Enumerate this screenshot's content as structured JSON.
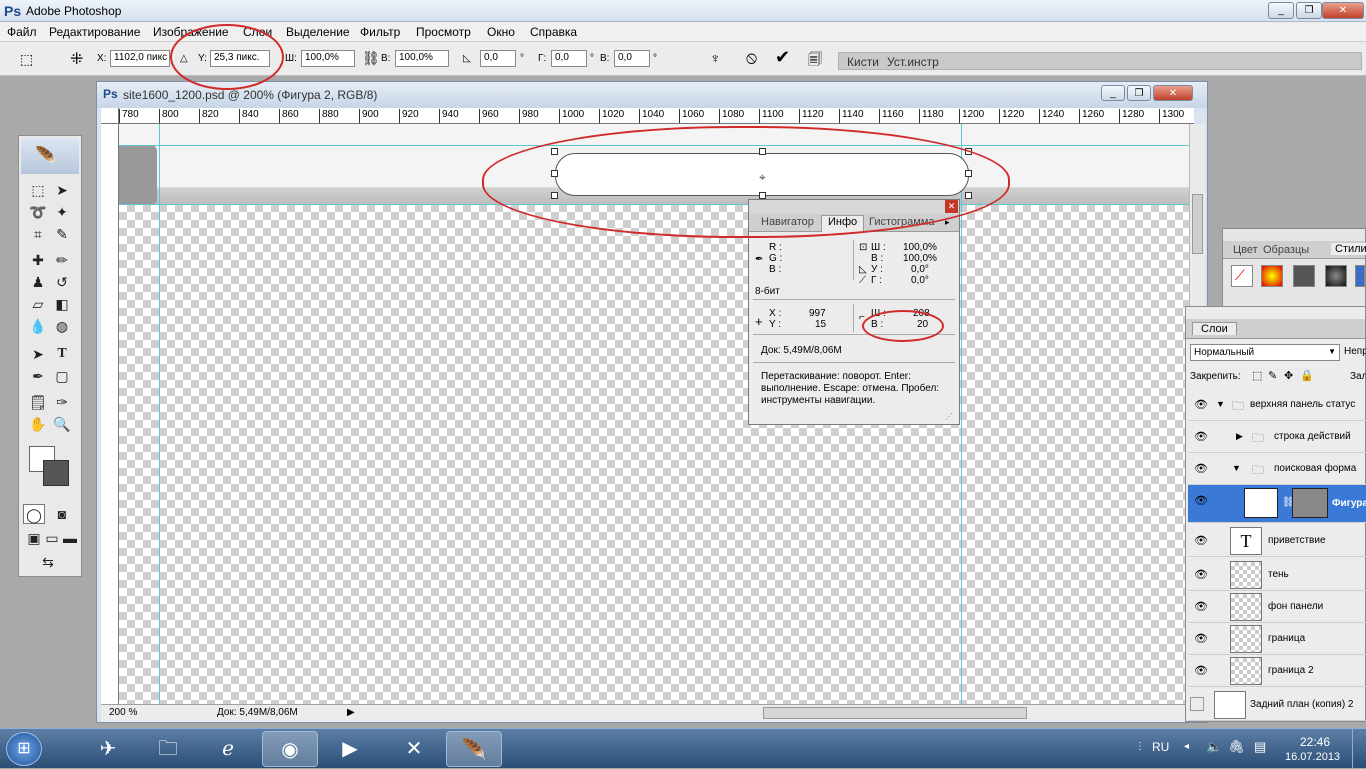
{
  "app": {
    "title": "Adobe Photoshop",
    "window_buttons": [
      "_",
      "❐",
      "✕"
    ]
  },
  "menu": [
    "Файл",
    "Редактирование",
    "Изображение",
    "Слои",
    "Выделение",
    "Фильтр",
    "Просмотр",
    "Окно",
    "Справка"
  ],
  "options": {
    "x_label": "X:",
    "x_value": "1102,0 пикс",
    "y_label": "Y:",
    "y_value": "25,3 пикс.",
    "w_label": "Ш:",
    "w_value": "100,0%",
    "h_label": "В:",
    "h_value": "100,0%",
    "angle_value": "0,0",
    "degree": "°",
    "hskew_label": "Г:",
    "hskew_value": "0,0",
    "vskew_label": "В:",
    "vskew_value": "0,0",
    "brush_tabs": [
      "Кисти",
      "Уст.инстр"
    ]
  },
  "document": {
    "title": "site1600_1200.psd @ 200% (Фигура 2, RGB/8)",
    "ruler_marks": [
      "780",
      "800",
      "820",
      "840",
      "860",
      "880",
      "900",
      "920",
      "940",
      "960",
      "980",
      "1000",
      "1020",
      "1040",
      "1060",
      "1080",
      "1100",
      "1120",
      "1140",
      "1160",
      "1180",
      "1200",
      "1220",
      "1240",
      "1260",
      "1280",
      "1300"
    ],
    "zoom": "200 %",
    "doc_status": "Док: 5,49M/8,06M"
  },
  "info_panel": {
    "tabs": [
      "Навигатор",
      "Инфо",
      "Гистограмма"
    ],
    "active_tab": "Инфо",
    "r_label": "R :",
    "g_label": "G :",
    "b_label": "B :",
    "w_label": "Ш :",
    "w_value": "100,0%",
    "h_label": "В :",
    "h_value": "100,0%",
    "u_label": "У :",
    "u_value": "0,0°",
    "g2_label": "Г :",
    "g2_value": "0,0°",
    "bit": "8-бит",
    "x_label": "X :",
    "x_value": "997",
    "y_label": "Y :",
    "y_value": "15",
    "sw_label": "Ш :",
    "sw_value": "208",
    "sh_label": "В :",
    "sh_value": "20",
    "doc": "Док: 5,49M/8,06M",
    "hint": "Перетаскивание: поворот. Enter: выполнение. Escape: отмена. Пробел: инструменты навигации."
  },
  "styles_panel": {
    "tabs": [
      "Цвет",
      "Образцы",
      "Стили"
    ]
  },
  "layers_panel": {
    "tab": "Слои",
    "blend_mode": "Нормальный",
    "opacity_label": "Непр",
    "lock_label": "Закрепить:",
    "fill_label": "Зал",
    "layers": [
      {
        "name": "верхняя панель статус",
        "type": "group",
        "indent": 0
      },
      {
        "name": "строка действий",
        "type": "group",
        "indent": 1
      },
      {
        "name": "поисковая форма",
        "type": "group",
        "indent": 1
      },
      {
        "name": "Фигура",
        "type": "shape",
        "indent": 2,
        "selected": true
      },
      {
        "name": "приветствие",
        "type": "text",
        "indent": 2
      },
      {
        "name": "тень",
        "type": "layer",
        "indent": 2
      },
      {
        "name": "фон панели",
        "type": "layer",
        "indent": 2
      },
      {
        "name": "граница",
        "type": "layer",
        "indent": 2
      },
      {
        "name": "граница 2",
        "type": "layer",
        "indent": 2
      },
      {
        "name": "Задний план (копия) 2",
        "type": "layer",
        "indent": 0
      }
    ]
  },
  "taskbar": {
    "language": "RU",
    "time": "22:46",
    "date": "16.07.2013"
  },
  "colors": {
    "selection_blue": "#3b79d6",
    "annotation_red": "#d12a2a"
  }
}
